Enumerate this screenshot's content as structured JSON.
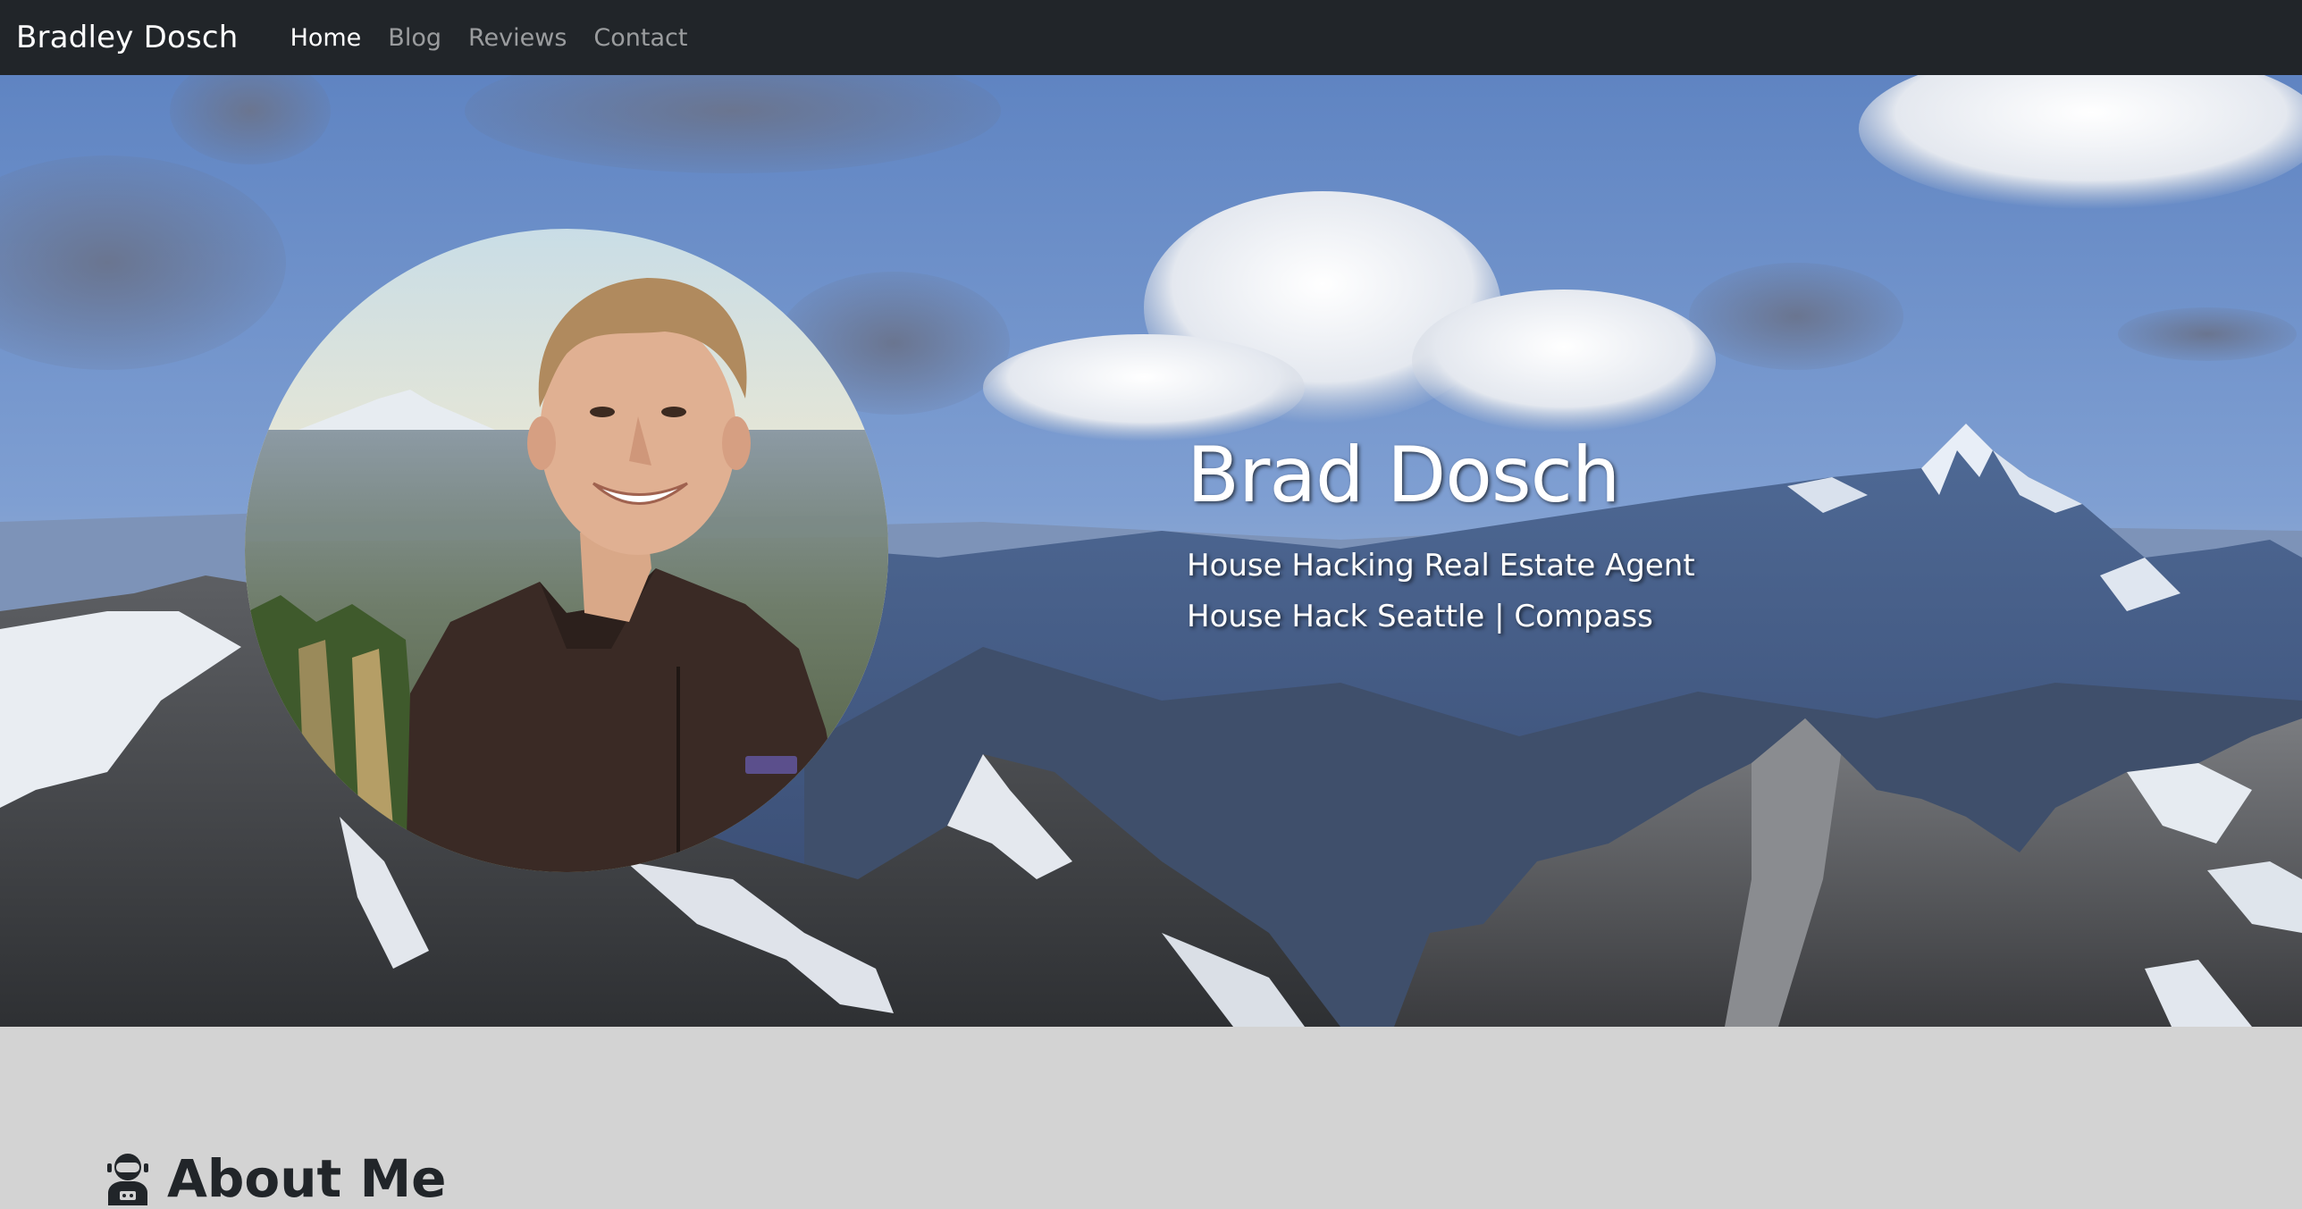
{
  "nav": {
    "brand": "Bradley Dosch",
    "links": [
      {
        "label": "Home",
        "active": true
      },
      {
        "label": "Blog",
        "active": false
      },
      {
        "label": "Reviews",
        "active": false
      },
      {
        "label": "Contact",
        "active": false
      }
    ]
  },
  "hero": {
    "name": "Brad Dosch",
    "line1": "House Hacking Real Estate Agent",
    "line2": "House Hack Seattle | Compass",
    "background": "mountain-landscape-photo",
    "portrait": "profile-photo"
  },
  "about": {
    "icon": "user-astronaut-icon",
    "heading": "About Me"
  },
  "colors": {
    "navbar": "#212529",
    "nav_active": "#ffffff",
    "nav_inactive": "#8c8f92",
    "about_bg": "#d3d3d3",
    "sky": "#6d8fc4"
  }
}
